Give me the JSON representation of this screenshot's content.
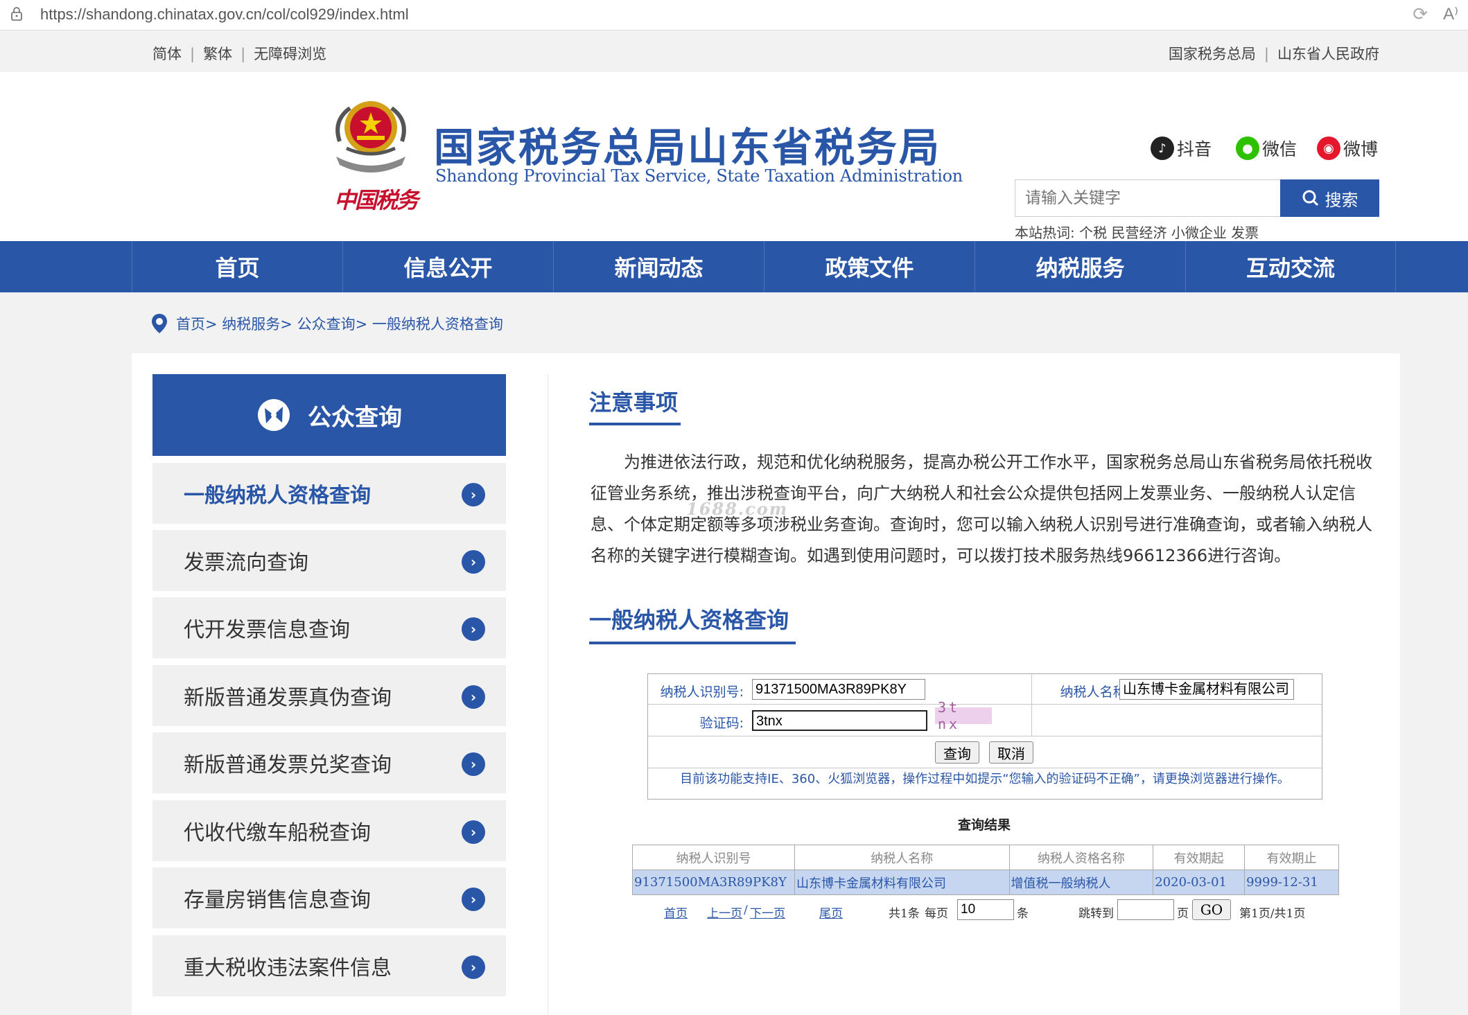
{
  "browser": {
    "url": "https://shandong.chinatax.gov.cn/col/col929/index.html",
    "reader_glyph": "A⁾"
  },
  "topbar": {
    "left_links": [
      "简体",
      "繁体",
      "无障碍浏览"
    ],
    "right_links": [
      "国家税务总局",
      "山东省人民政府"
    ]
  },
  "header": {
    "emblem_caption": "中国税务",
    "title": "国家税务总局山东省税务局",
    "subtitle": "Shandong Provincial Tax Service, State Taxation Administration",
    "social": [
      "抖音",
      "微信",
      "微博"
    ],
    "search_placeholder": "请输入关键字",
    "search_button": "搜索",
    "hot_label": "本站热词:",
    "hot_words": "个税 民营经济 小微企业 发票"
  },
  "nav": [
    "首页",
    "信息公开",
    "新闻动态",
    "政策文件",
    "纳税服务",
    "互动交流"
  ],
  "breadcrumb": [
    "首页>",
    "纳税服务>",
    "公众查询>",
    "一般纳税人资格查询"
  ],
  "sidebar": {
    "title": "公众查询",
    "items": [
      "一般纳税人资格查询",
      "发票流向查询",
      "代开发票信息查询",
      "新版普通发票真伪查询",
      "新版普通发票兑奖查询",
      "代收代缴车船税查询",
      "存量房销售信息查询",
      "重大税收违法案件信息"
    ],
    "active_index": 0
  },
  "notice": {
    "title": "注意事项",
    "body": "为推进依法行政，规范和优化纳税服务，提高办税公开工作水平，国家税务总局山东省税务局依托税收征管业务系统，推出涉税查询平台，向广大纳税人和社会公众提供包括网上发票业务、一般纳税人认定信息、个体定期定额等多项涉税业务查询。查询时，您可以输入纳税人识别号进行准确查询，或者输入纳税人名称的关键字进行模糊查询。如遇到使用问题时，可以拨打技术服务热线96612366进行咨询。",
    "watermark": "1688.com"
  },
  "query": {
    "title": "一般纳税人资格查询",
    "taxpayer_id_label": "纳税人识别号:",
    "taxpayer_id_value": "91371500MA3R89PK8Y",
    "taxpayer_name_label": "纳税人名称:",
    "taxpayer_name_value": "山东博卡金属材料有限公司",
    "captcha_label": "验证码:",
    "captcha_value": "3tnx",
    "captcha_image_text": "3t nx",
    "submit_button": "查询",
    "cancel_button": "取消",
    "tip": "目前该功能支持IE、360、火狐浏览器，操作过程中如提示“您输入的验证码不正确”，请更换浏览器进行操作。"
  },
  "results": {
    "title": "查询结果",
    "columns": [
      "纳税人识别号",
      "纳税人名称",
      "纳税人资格名称",
      "有效期起",
      "有效期止"
    ],
    "rows": [
      [
        "91371500MA3R89PK8Y",
        "山东博卡金属材料有限公司",
        "增值税一般纳税人",
        "2020-03-01",
        "9999-12-31"
      ]
    ]
  },
  "pager": {
    "first": "首页",
    "prev": "上一页",
    "slash": "/",
    "next": "下一页",
    "last": "尾页",
    "total": "共1条",
    "per_page_label": "每页",
    "per_page_value": "10",
    "per_page_unit": "条",
    "jump_label": "跳转到",
    "jump_unit": "页",
    "go": "GO",
    "page_info": "第1页/共1页"
  },
  "colors": {
    "brand_blue": "#2a56a8",
    "emblem_red": "#c8102e",
    "result_row_bg": "#c6d6f0"
  }
}
